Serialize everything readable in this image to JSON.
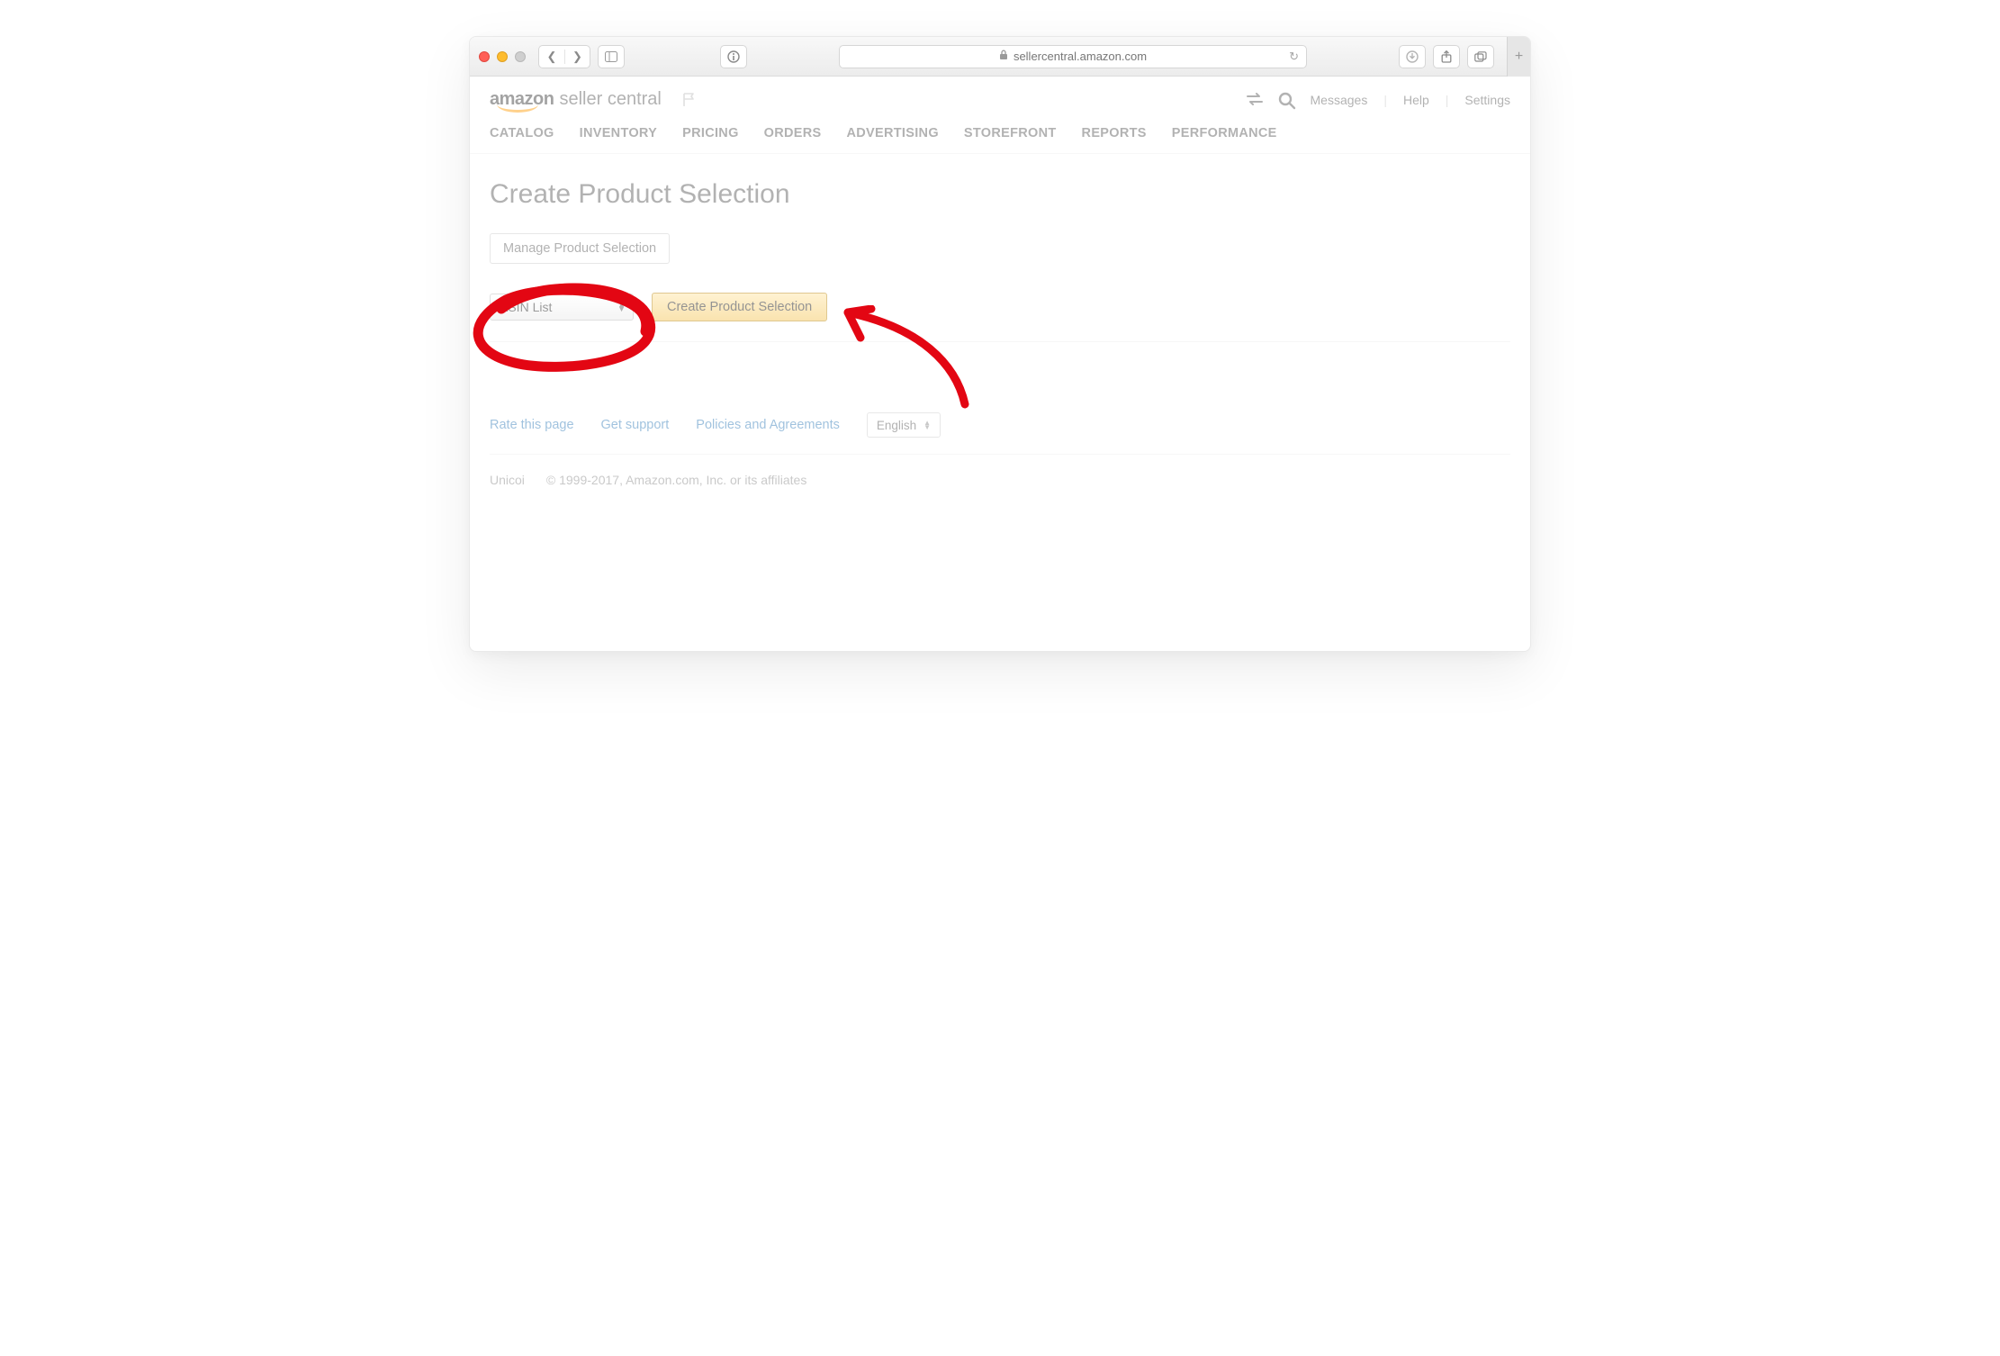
{
  "browser": {
    "url": "sellercentral.amazon.com"
  },
  "header": {
    "logo_amazon": "amazon",
    "logo_rest": "seller central",
    "links": {
      "messages": "Messages",
      "help": "Help",
      "settings": "Settings"
    }
  },
  "nav": {
    "items": [
      "CATALOG",
      "INVENTORY",
      "PRICING",
      "ORDERS",
      "ADVERTISING",
      "STOREFRONT",
      "REPORTS",
      "PERFORMANCE"
    ]
  },
  "main": {
    "title": "Create Product Selection",
    "manage_btn": "Manage Product Selection",
    "select_value": "ASIN List",
    "create_btn": "Create Product Selection"
  },
  "footer": {
    "links": [
      "Rate this page",
      "Get support",
      "Policies and Agreements"
    ],
    "language": "English",
    "brand": "Unicoi",
    "copyright": "© 1999-2017, Amazon.com, Inc. or its affiliates"
  }
}
